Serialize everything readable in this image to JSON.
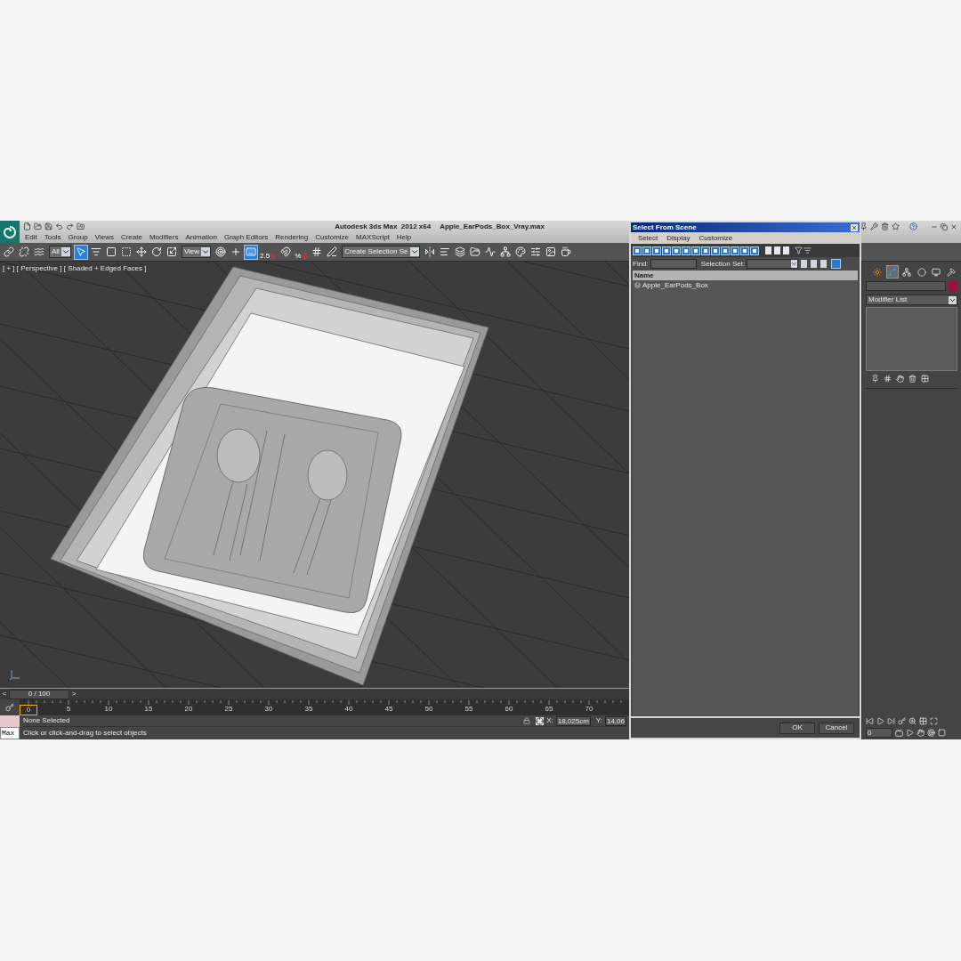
{
  "window": {
    "title": "Autodesk 3ds Max  2012 x64",
    "file_name": "Apple_EarPods_Box_Vray.max"
  },
  "menu": [
    "Edit",
    "Tools",
    "Group",
    "Views",
    "Create",
    "Modifiers",
    "Animation",
    "Graph Editors",
    "Rendering",
    "Customize",
    "MAXScript",
    "Help"
  ],
  "toolbar": [
    {
      "kind": "button",
      "selected": false
    },
    {
      "kind": "button",
      "selected": false
    },
    {
      "kind": "button",
      "selected": false
    },
    {
      "kind": "dropdown",
      "value": "All"
    },
    {
      "kind": "button",
      "selected": true
    },
    {
      "kind": "button",
      "selected": false
    },
    {
      "kind": "button",
      "selected": false
    },
    {
      "kind": "button",
      "selected": false
    },
    {
      "kind": "button",
      "selected": false
    },
    {
      "kind": "button",
      "selected": false
    },
    {
      "kind": "button",
      "selected": false
    },
    {
      "kind": "dropdown",
      "value": "View"
    },
    {
      "kind": "button",
      "selected": false
    },
    {
      "kind": "button",
      "selected": false
    },
    {
      "kind": "button",
      "selected": true
    },
    {
      "kind": "snap",
      "label": "2.5"
    },
    {
      "kind": "button",
      "selected": false
    },
    {
      "kind": "snap",
      "label": "%"
    },
    {
      "kind": "button",
      "selected": false
    },
    {
      "kind": "button",
      "selected": false
    },
    {
      "kind": "dropdown",
      "value": "Create Selection Se"
    },
    {
      "kind": "button",
      "selected": false
    },
    {
      "kind": "button",
      "selected": false
    },
    {
      "kind": "button",
      "selected": false
    },
    {
      "kind": "button",
      "selected": false
    },
    {
      "kind": "button",
      "selected": false
    },
    {
      "kind": "button",
      "selected": false
    },
    {
      "kind": "button",
      "selected": false
    },
    {
      "kind": "button",
      "selected": false
    },
    {
      "kind": "button",
      "selected": false
    },
    {
      "kind": "button",
      "selected": false
    }
  ],
  "viewport": {
    "label": "[ + ] [ Perspective ] [ Shaded + Edged Faces ]"
  },
  "time_slider": {
    "prev": "<",
    "frame": "0 / 100",
    "next": ">"
  },
  "track_bar": {
    "ticks": [
      "0",
      "5",
      "10",
      "15",
      "20",
      "25",
      "30",
      "35",
      "40",
      "45",
      "50",
      "55",
      "60",
      "65",
      "70"
    ]
  },
  "status": {
    "selection": "None Selected",
    "prompt": "Click or click-and-drag to select objects",
    "listener": "Max",
    "x_label": "X:",
    "x_value": "18,025cm",
    "y_label": "Y:",
    "y_value": "14,06"
  },
  "dialog": {
    "title": "Select From Scene",
    "menu": [
      "Select",
      "Display",
      "Customize"
    ],
    "filters": [
      {
        "on": true
      },
      {
        "on": true
      },
      {
        "on": true
      },
      {
        "on": true
      },
      {
        "on": true
      },
      {
        "on": true
      },
      {
        "on": true
      },
      {
        "on": true
      },
      {
        "on": true
      },
      {
        "on": true
      },
      {
        "on": true
      },
      {
        "on": true
      },
      {
        "on": true
      }
    ],
    "find_label": "Find:",
    "selection_set_label": "Selection Set:",
    "column": "Name",
    "rows": [
      {
        "name": "Apple_EarPods_Box",
        "selected": false
      }
    ],
    "buttons": [
      "OK",
      "Cancel"
    ]
  },
  "command_panel": {
    "tabs": [
      {
        "selected": false
      },
      {
        "selected": true
      },
      {
        "selected": false
      },
      {
        "selected": false
      },
      {
        "selected": false
      },
      {
        "selected": false
      }
    ],
    "color": "#a0103a",
    "modifier_list": "Modifier List",
    "frame": "0"
  }
}
